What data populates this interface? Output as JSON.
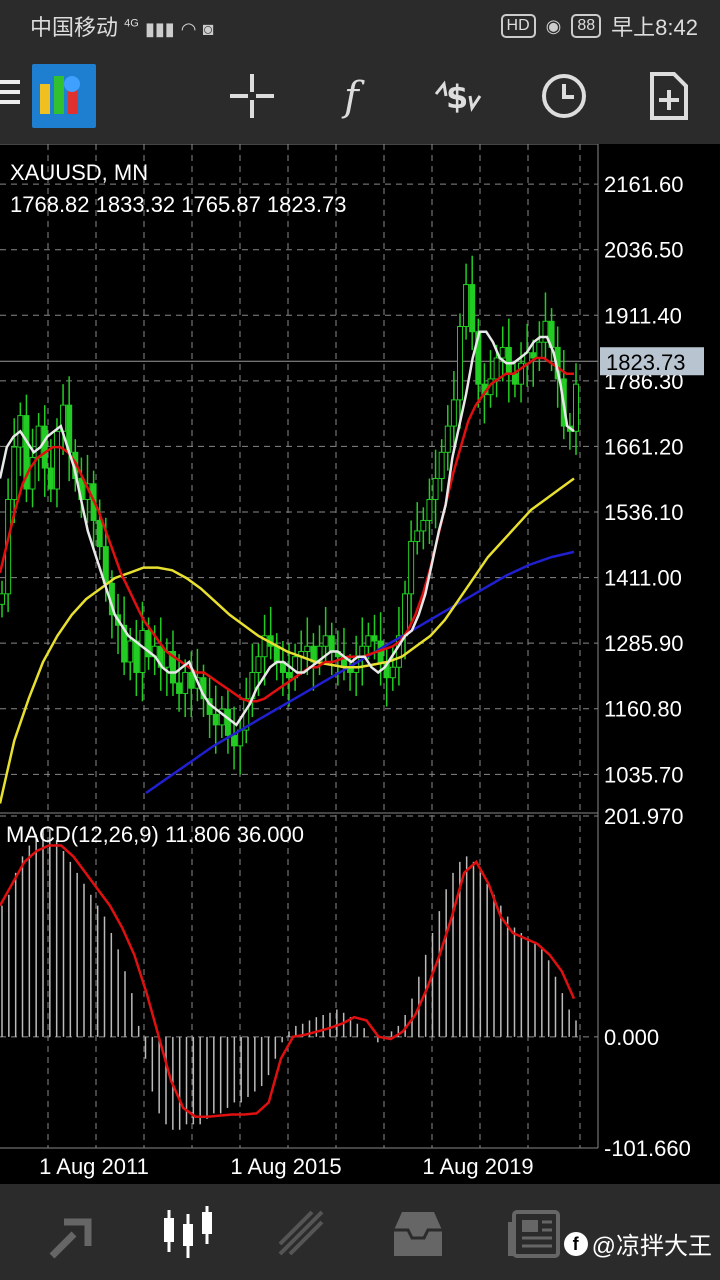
{
  "status_bar": {
    "carrier": "中国移动",
    "network": "4G",
    "hd": "HD",
    "battery": "88",
    "time": "早上8:42"
  },
  "toolbar": {
    "icons": [
      "menu-icon",
      "metatrader-logo",
      "crosshair-icon",
      "function-icon",
      "trade-icon",
      "clock-icon",
      "new-document-icon"
    ]
  },
  "chart": {
    "symbol_label": "XAUUSD, MN",
    "ohlc_label": "1768.82 1833.32 1765.87 1823.73",
    "current_price_label": "1823.73",
    "macd_label": "MACD(12,26,9) 11.806 36.000"
  },
  "chart_data": [
    {
      "type": "candlestick",
      "symbol": "XAUUSD",
      "timeframe": "MN",
      "last": 1823.73,
      "ohlc": {
        "open": 1768.82,
        "high": 1833.32,
        "low": 1765.87,
        "close": 1823.73
      },
      "y_ticks": [
        "2161.60",
        "2036.50",
        "1911.40",
        "1786.30",
        "1661.20",
        "1536.10",
        "1411.00",
        "1285.90",
        "1160.80",
        "1035.70"
      ],
      "x_ticks": [
        "1 Aug 2011",
        "1 Aug 2015",
        "1 Aug 2019"
      ],
      "ylim": [
        960,
        2200
      ],
      "grid": true,
      "colors": {
        "candles": "#22cc22",
        "ma_fast": "#e8e8e8",
        "ma_mid": "#e01010",
        "ma_slow": "#e8e030",
        "ma_long": "#2020d0"
      },
      "closes": [
        1380,
        1560,
        1660,
        1720,
        1580,
        1640,
        1700,
        1620,
        1580,
        1690,
        1740,
        1650,
        1600,
        1560,
        1590,
        1520,
        1470,
        1400,
        1340,
        1320,
        1250,
        1290,
        1230,
        1310,
        1260,
        1280,
        1240,
        1270,
        1210,
        1190,
        1230,
        1200,
        1220,
        1180,
        1150,
        1130,
        1160,
        1110,
        1090,
        1120,
        1180,
        1230,
        1260,
        1300,
        1280,
        1250,
        1230,
        1220,
        1260,
        1270,
        1280,
        1250,
        1280,
        1300,
        1270,
        1260,
        1240,
        1230,
        1260,
        1280,
        1300,
        1290,
        1250,
        1220,
        1240,
        1300,
        1380,
        1480,
        1500,
        1520,
        1560,
        1600,
        1650,
        1700,
        1750,
        1890,
        1970,
        1880,
        1780,
        1760,
        1790,
        1830,
        1850,
        1800,
        1780,
        1820,
        1840,
        1830,
        1860,
        1900,
        1850,
        1790,
        1700,
        1690,
        1780
      ],
      "ma_fast": [
        1600,
        1660,
        1680,
        1690,
        1670,
        1650,
        1660,
        1680,
        1690,
        1700,
        1660,
        1620,
        1560,
        1500,
        1460,
        1420,
        1380,
        1340,
        1320,
        1300,
        1290,
        1280,
        1270,
        1260,
        1240,
        1230,
        1230,
        1240,
        1250,
        1220,
        1190,
        1170,
        1160,
        1150,
        1140,
        1130,
        1150,
        1170,
        1200,
        1220,
        1240,
        1250,
        1250,
        1240,
        1230,
        1230,
        1240,
        1250,
        1260,
        1270,
        1270,
        1260,
        1250,
        1260,
        1260,
        1240,
        1230,
        1240,
        1260,
        1280,
        1300,
        1310,
        1340,
        1380,
        1440,
        1500,
        1550,
        1640,
        1700,
        1760,
        1830,
        1880,
        1880,
        1860,
        1830,
        1820,
        1820,
        1830,
        1840,
        1860,
        1870,
        1870,
        1840,
        1780,
        1700,
        1690
      ],
      "ma_mid": [
        1420,
        1480,
        1540,
        1590,
        1620,
        1640,
        1650,
        1660,
        1660,
        1650,
        1630,
        1600,
        1570,
        1540,
        1500,
        1460,
        1420,
        1390,
        1360,
        1330,
        1310,
        1290,
        1270,
        1260,
        1250,
        1240,
        1230,
        1230,
        1220,
        1210,
        1200,
        1190,
        1180,
        1175,
        1175,
        1180,
        1190,
        1200,
        1210,
        1220,
        1230,
        1240,
        1240,
        1250,
        1250,
        1255,
        1260,
        1260,
        1260,
        1265,
        1270,
        1275,
        1280,
        1290,
        1310,
        1340,
        1380,
        1430,
        1490,
        1550,
        1610,
        1660,
        1710,
        1740,
        1760,
        1780,
        1790,
        1800,
        1800,
        1810,
        1820,
        1830,
        1830,
        1820,
        1810,
        1800,
        1800
      ],
      "ma_slow": [
        980,
        1100,
        1180,
        1250,
        1300,
        1340,
        1370,
        1390,
        1410,
        1420,
        1430,
        1430,
        1425,
        1410,
        1390,
        1365,
        1340,
        1320,
        1300,
        1285,
        1270,
        1260,
        1250,
        1245,
        1240,
        1240,
        1245,
        1250,
        1260,
        1280,
        1300,
        1330,
        1370,
        1410,
        1450,
        1480,
        1510,
        1540,
        1560,
        1580,
        1600
      ],
      "ma_long": [
        1000,
        1030,
        1060,
        1090,
        1115,
        1140,
        1165,
        1190,
        1215,
        1240,
        1265,
        1290,
        1315,
        1340,
        1365,
        1390,
        1415,
        1435,
        1450,
        1460
      ]
    },
    {
      "type": "histogram+line",
      "name": "MACD(12,26,9)",
      "main": 11.806,
      "signal": 36.0,
      "y_ticks": [
        "201.970",
        "0.000",
        "-101.660"
      ],
      "ylim": [
        -101.66,
        201.97
      ],
      "histogram": [
        120,
        130,
        150,
        165,
        175,
        185,
        190,
        190,
        180,
        170,
        160,
        150,
        140,
        130,
        120,
        110,
        95,
        80,
        60,
        40,
        10,
        -20,
        -50,
        -70,
        -80,
        -85,
        -85,
        -80,
        -80,
        -80,
        -75,
        -70,
        -70,
        -65,
        -60,
        -60,
        -55,
        -50,
        -45,
        -35,
        -20,
        -5,
        5,
        10,
        12,
        15,
        18,
        20,
        22,
        25,
        22,
        18,
        12,
        8,
        0,
        -5,
        -2,
        5,
        10,
        20,
        35,
        55,
        75,
        95,
        115,
        135,
        150,
        160,
        165,
        160,
        150,
        140,
        130,
        120,
        110,
        100,
        95,
        90,
        85,
        80,
        70,
        55,
        40,
        25,
        15
      ],
      "signal_line": [
        120,
        140,
        160,
        170,
        175,
        175,
        165,
        150,
        135,
        120,
        100,
        75,
        40,
        0,
        -40,
        -65,
        -73,
        -73,
        -72,
        -71,
        -71,
        -70,
        -60,
        -20,
        0,
        2,
        5,
        8,
        12,
        18,
        15,
        0,
        -2,
        5,
        20,
        45,
        75,
        110,
        150,
        160,
        140,
        110,
        95,
        90,
        85,
        75,
        60,
        35
      ]
    }
  ],
  "bottom_nav": {
    "icons": [
      "quotes-icon",
      "chart-icon",
      "trade-icon",
      "history-icon",
      "news-icon"
    ],
    "watermark": "@凉拌大王"
  }
}
